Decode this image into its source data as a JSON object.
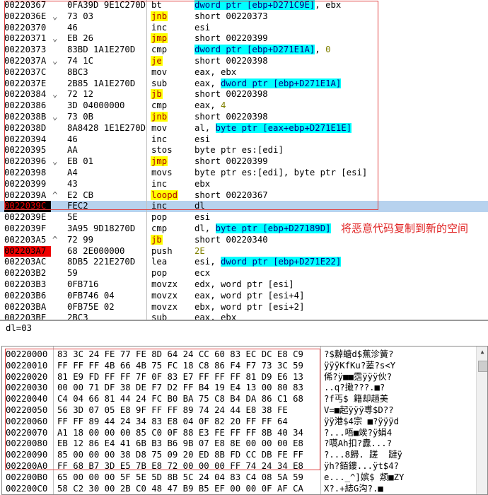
{
  "disasm": {
    "rows": [
      {
        "addr": "00220367",
        "arrow": "",
        "hex": "0FA39D 9E1C270D",
        "mn": "bt",
        "hl": false,
        "ops": [
          {
            "t": "dword ptr [ebp+D271C9E]",
            "k": "a"
          },
          {
            "t": ", ebx",
            "k": ""
          }
        ],
        "sel": false,
        "mark": ""
      },
      {
        "addr": "0022036E",
        "arrow": "⌄",
        "hex": "73 03",
        "mn": "jnb",
        "hl": true,
        "ops": [
          {
            "t": "short 00220373",
            "k": ""
          }
        ],
        "sel": false,
        "mark": ""
      },
      {
        "addr": "00220370",
        "arrow": "",
        "hex": "46",
        "mn": "inc",
        "hl": false,
        "ops": [
          {
            "t": "esi",
            "k": ""
          }
        ],
        "sel": false,
        "mark": ""
      },
      {
        "addr": "00220371",
        "arrow": "⌄",
        "hex": "EB 26",
        "mn": "jmp",
        "hl": true,
        "ops": [
          {
            "t": "short 00220399",
            "k": ""
          }
        ],
        "sel": false,
        "mark": ""
      },
      {
        "addr": "00220373",
        "arrow": "",
        "hex": "83BD 1A1E270D",
        "mn": "cmp",
        "hl": false,
        "ops": [
          {
            "t": "dword ptr [ebp+D271E1A]",
            "k": "a"
          },
          {
            "t": ", ",
            "k": ""
          },
          {
            "t": "0",
            "k": "n"
          }
        ],
        "sel": false,
        "mark": ""
      },
      {
        "addr": "0022037A",
        "arrow": "⌄",
        "hex": "74 1C",
        "mn": "je",
        "hl": true,
        "ops": [
          {
            "t": "short 00220398",
            "k": ""
          }
        ],
        "sel": false,
        "mark": ""
      },
      {
        "addr": "0022037C",
        "arrow": "",
        "hex": "8BC3",
        "mn": "mov",
        "hl": false,
        "ops": [
          {
            "t": "eax, ebx",
            "k": ""
          }
        ],
        "sel": false,
        "mark": ""
      },
      {
        "addr": "0022037E",
        "arrow": "",
        "hex": "2B85 1A1E270D",
        "mn": "sub",
        "hl": false,
        "ops": [
          {
            "t": "eax, ",
            "k": ""
          },
          {
            "t": "dword ptr [ebp+D271E1A]",
            "k": "a"
          }
        ],
        "sel": false,
        "mark": ""
      },
      {
        "addr": "00220384",
        "arrow": "⌄",
        "hex": "72 12",
        "mn": "jb",
        "hl": true,
        "ops": [
          {
            "t": "short 00220398",
            "k": ""
          }
        ],
        "sel": false,
        "mark": ""
      },
      {
        "addr": "00220386",
        "arrow": "",
        "hex": "3D 04000000",
        "mn": "cmp",
        "hl": false,
        "ops": [
          {
            "t": "eax, ",
            "k": ""
          },
          {
            "t": "4",
            "k": "n"
          }
        ],
        "sel": false,
        "mark": ""
      },
      {
        "addr": "0022038B",
        "arrow": "⌄",
        "hex": "73 0B",
        "mn": "jnb",
        "hl": true,
        "ops": [
          {
            "t": "short 00220398",
            "k": ""
          }
        ],
        "sel": false,
        "mark": ""
      },
      {
        "addr": "0022038D",
        "arrow": "",
        "hex": "8A8428 1E1E270D",
        "mn": "mov",
        "hl": false,
        "ops": [
          {
            "t": "al, ",
            "k": ""
          },
          {
            "t": "byte ptr [eax+ebp+D271E1E]",
            "k": "a"
          }
        ],
        "sel": false,
        "mark": ""
      },
      {
        "addr": "00220394",
        "arrow": "",
        "hex": "46",
        "mn": "inc",
        "hl": false,
        "ops": [
          {
            "t": "esi",
            "k": ""
          }
        ],
        "sel": false,
        "mark": ""
      },
      {
        "addr": "00220395",
        "arrow": "",
        "hex": "AA",
        "mn": "stos",
        "hl": false,
        "ops": [
          {
            "t": "byte ptr es:[edi]",
            "k": ""
          }
        ],
        "sel": false,
        "mark": ""
      },
      {
        "addr": "00220396",
        "arrow": "⌄",
        "hex": "EB 01",
        "mn": "jmp",
        "hl": true,
        "ops": [
          {
            "t": "short 00220399",
            "k": ""
          }
        ],
        "sel": false,
        "mark": ""
      },
      {
        "addr": "00220398",
        "arrow": "",
        "hex": "A4",
        "mn": "movs",
        "hl": false,
        "ops": [
          {
            "t": "byte ptr es:[edi], byte ptr [esi]",
            "k": ""
          }
        ],
        "sel": false,
        "mark": ""
      },
      {
        "addr": "00220399",
        "arrow": "",
        "hex": "43",
        "mn": "inc",
        "hl": false,
        "ops": [
          {
            "t": "ebx",
            "k": ""
          }
        ],
        "sel": false,
        "mark": ""
      },
      {
        "addr": "0022039A",
        "arrow": "^",
        "hex": "E2 CB",
        "mn": "loopd",
        "hl": true,
        "ops": [
          {
            "t": "short 00220367",
            "k": ""
          }
        ],
        "sel": false,
        "mark": ""
      },
      {
        "addr": "0022039C",
        "arrow": "",
        "hex": "FEC2",
        "mn": "inc",
        "hl": false,
        "ops": [
          {
            "t": "dl",
            "k": ""
          }
        ],
        "sel": true,
        "mark": "cur"
      },
      {
        "addr": "0022039E",
        "arrow": "",
        "hex": "5E",
        "mn": "pop",
        "hl": false,
        "ops": [
          {
            "t": "esi",
            "k": ""
          }
        ],
        "sel": false,
        "mark": ""
      },
      {
        "addr": "0022039F",
        "arrow": "",
        "hex": "3A95 9D18270D",
        "mn": "cmp",
        "hl": false,
        "ops": [
          {
            "t": "dl, ",
            "k": ""
          },
          {
            "t": "byte ptr [ebp+D27189D]",
            "k": "a"
          }
        ],
        "sel": false,
        "mark": ""
      },
      {
        "addr": "002203A5",
        "arrow": "^",
        "hex": "72 99",
        "mn": "jb",
        "hl": true,
        "ops": [
          {
            "t": "short 00220340",
            "k": ""
          }
        ],
        "sel": false,
        "mark": ""
      },
      {
        "addr": "002203A7",
        "arrow": "",
        "hex": "68 2E000000",
        "mn": "push",
        "hl": false,
        "ops": [
          {
            "t": "2E",
            "k": "n"
          }
        ],
        "sel": false,
        "mark": "bp"
      },
      {
        "addr": "002203AC",
        "arrow": "",
        "hex": "8DB5 221E270D",
        "mn": "lea",
        "hl": false,
        "ops": [
          {
            "t": "esi, ",
            "k": ""
          },
          {
            "t": "dword ptr [ebp+D271E22]",
            "k": "a"
          }
        ],
        "sel": false,
        "mark": ""
      },
      {
        "addr": "002203B2",
        "arrow": "",
        "hex": "59",
        "mn": "pop",
        "hl": false,
        "ops": [
          {
            "t": "ecx",
            "k": ""
          }
        ],
        "sel": false,
        "mark": ""
      },
      {
        "addr": "002203B3",
        "arrow": "",
        "hex": "0FB716",
        "mn": "movzx",
        "hl": false,
        "ops": [
          {
            "t": "edx, word ptr [esi]",
            "k": ""
          }
        ],
        "sel": false,
        "mark": ""
      },
      {
        "addr": "002203B6",
        "arrow": "",
        "hex": "0FB746 04",
        "mn": "movzx",
        "hl": false,
        "ops": [
          {
            "t": "eax, word ptr [esi+4]",
            "k": ""
          }
        ],
        "sel": false,
        "mark": ""
      },
      {
        "addr": "002203BA",
        "arrow": "",
        "hex": "0FB75E 02",
        "mn": "movzx",
        "hl": false,
        "ops": [
          {
            "t": "ebx, word ptr [esi+2]",
            "k": ""
          }
        ],
        "sel": false,
        "mark": ""
      },
      {
        "addr": "002203BE",
        "arrow": "",
        "hex": "2BC3",
        "mn": "sub",
        "hl": false,
        "ops": [
          {
            "t": "eax, ebx",
            "k": ""
          }
        ],
        "sel": false,
        "mark": ""
      }
    ]
  },
  "info": {
    "text": "dl=03"
  },
  "dump": {
    "rows": [
      {
        "addr": "00220000",
        "hex": "83 3C 24 FE 77 FE 8D 64 24 CC 60 83 EC DC E8 C9",
        "ascii": "?$繛螗d$蕉沴簧?"
      },
      {
        "addr": "00220010",
        "hex": "FF FF FF 4B 66 4B 75 FC 18 C8 86 F4 F7 73 3C 59",
        "ascii": "ÿÿÿKfKu?蒫?s<Y"
      },
      {
        "addr": "00220020",
        "hex": "81 E9 FD FF FF 7F 0F 83 E7 FF FF FF 81 D9 E6 13",
        "ascii": "俙?ÿ■■霑ÿÿÿ伙?"
      },
      {
        "addr": "00220030",
        "hex": "00 00 71 DF 38 DE F7 D2 FF B4 19 E4 13 00 80 83",
        "ascii": "..q?撖???.■?"
      },
      {
        "addr": "00220040",
        "hex": "C4 04 66 81 44 24 FC B0 BA 75 C8 B4 DA 86 C1 68",
        "ascii": "?f丐$ 籍却趟美"
      },
      {
        "addr": "00220050",
        "hex": "56 3D 07 05 E8 9F FF FF 89 74 24 44 E8 38 FE",
        "ascii": "V=■起ÿÿÿ尃$D??"
      },
      {
        "addr": "00220060",
        "hex": "FF FF 89 44 24 34 83 E8 04 0F 82 20 FF FF 64",
        "ascii": "ÿÿ港$4宗 ■?ÿÿÿd"
      },
      {
        "addr": "00220070",
        "hex": "A1 18 00 00 00 85 C0 0F 88 E3 FE FF FF 8B 40 34",
        "ascii": "?...唔■竢?ÿ娟4"
      },
      {
        "addr": "00220080",
        "hex": "EB 12 86 E4 41 6B B3 B6 9B 07 E8 8E 00 00 00 E8",
        "ascii": "?嚆Ah扣?纛...?"
      },
      {
        "addr": "00220090",
        "hex": "85 00 00 00 38 D8 75 09 20 ED 8B FD CC DB FE FF",
        "ascii": "?...8歸. 蹉  躂ÿ"
      },
      {
        "addr": "002200A0",
        "hex": "FF 68 B7 3D E5 7B E8 72 00 00 00 FF 74 24 34 E8",
        "ascii": "ÿh?銆鏤...ÿt$4?"
      },
      {
        "addr": "002200B0",
        "hex": "65 00 00 00 5F 5E 5D 8B 5C 24 04 83 C4 08 5A 59",
        "ascii": "e..._^]嫔$ 颒■ZY"
      },
      {
        "addr": "002200C0",
        "hex": "58 C2 30 00 2B C0 48 47 B9 B5 EF 00 00 0F AF CA",
        "ascii": "X?.+綕G沟?.■"
      }
    ]
  },
  "annotation": {
    "text": "将恶意代码复制到新的空间"
  }
}
